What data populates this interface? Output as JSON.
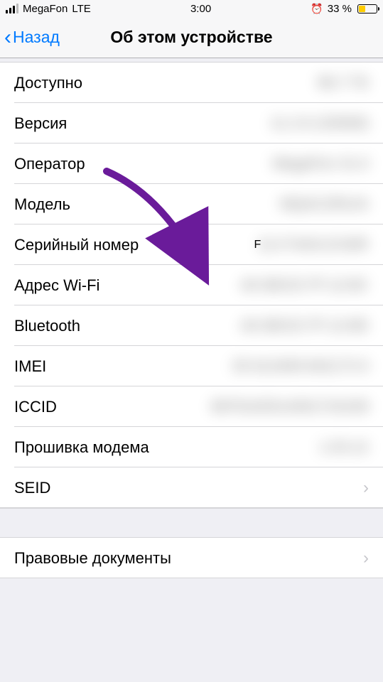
{
  "statusBar": {
    "carrier": "MegaFon",
    "network": "LTE",
    "time": "3:00",
    "batteryPercent": "33 %"
  },
  "nav": {
    "back": "Назад",
    "title": "Об этом устройстве"
  },
  "rows": {
    "available": {
      "label": "Доступно",
      "value": "86,7 ГБ"
    },
    "version": {
      "label": "Версия",
      "value": "11.2.6 (15D60)"
    },
    "carrier": {
      "label": "Оператор",
      "value": "MegaFon 31.0"
    },
    "model": {
      "label": "Модель",
      "value": "MQAC2RU/A"
    },
    "serial": {
      "label": "Серийный номер",
      "prefix": "F",
      "value": "2LV7AKKJCWR"
    },
    "wifi": {
      "label": "Адрес Wi-Fi",
      "value": "A0:3B:E3:7F:12:8C"
    },
    "bluetooth": {
      "label": "Bluetooth",
      "value": "A0:3B:E3:7F:12:8D"
    },
    "imei": {
      "label": "IMEI",
      "value": "35 612409 842173 0"
    },
    "iccid": {
      "label": "ICCID",
      "value": "8970102514301724159"
    },
    "modem": {
      "label": "Прошивка модема",
      "value": "1.03.12"
    },
    "seid": {
      "label": "SEID"
    },
    "legal": {
      "label": "Правовые документы"
    }
  }
}
